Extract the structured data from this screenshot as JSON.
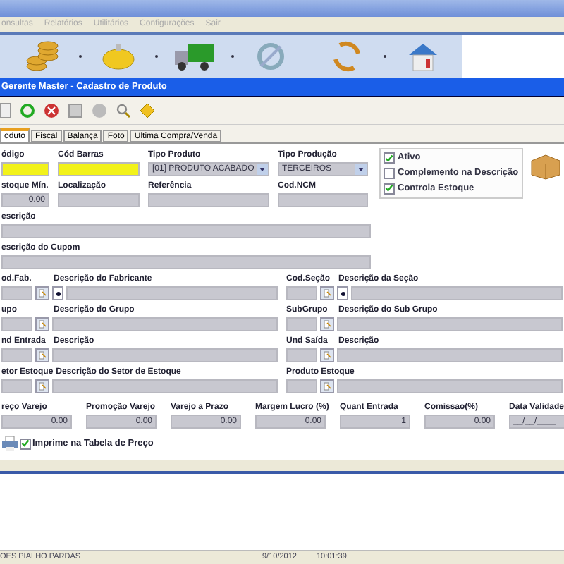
{
  "menu": [
    "onsultas",
    "Relatórios",
    "Utilitários",
    "Configurações",
    "Sair"
  ],
  "form_title": "Gerente Master - Cadastro de Produto",
  "tabs": [
    {
      "label": "oduto",
      "selected": true
    },
    {
      "label": "Fiscal",
      "selected": false
    },
    {
      "label": "Balança",
      "selected": false
    },
    {
      "label": "Foto",
      "selected": false
    },
    {
      "label": "Ultima Compra/Venda",
      "selected": false
    }
  ],
  "row_1": [
    {
      "label": "ódigo",
      "kind": "text",
      "required": true
    },
    {
      "label": "Cód Barras",
      "kind": "text",
      "required": true
    },
    {
      "label": "Tipo Produto",
      "kind": "select",
      "value": "[01] PRODUTO ACABADO"
    },
    {
      "label": "Tipo Produção",
      "kind": "select",
      "value": "TERCEIROS"
    }
  ],
  "row_2": [
    {
      "label": "stoque Mín.",
      "kind": "text",
      "value": "0.00",
      "required": false
    },
    {
      "label": "Localização",
      "kind": "text",
      "required": false
    },
    {
      "label": "Referência",
      "kind": "text",
      "required": false
    },
    {
      "label": "Cod.NCM",
      "kind": "text",
      "required": false
    }
  ],
  "options": [
    {
      "label": "Ativo",
      "checked": true
    },
    {
      "label": "Complemento na Descrição",
      "checked": false
    },
    {
      "label": "Controla Estoque",
      "checked": true
    }
  ],
  "description": {
    "label": "escrição"
  },
  "coupon_description": {
    "label": "escrição do Cupom"
  },
  "lookups": [
    {
      "code_label": "od.Fab.",
      "desc_label": "Descrição do Fabricante",
      "dot": true
    },
    {
      "code_label": "Cod.Seção",
      "desc_label": "Descrição da Seção",
      "dot": true
    },
    {
      "code_label": "upo",
      "desc_label": "Descrição do Grupo",
      "dot": false
    },
    {
      "code_label": "SubGrupo",
      "desc_label": "Descrição do Sub Grupo",
      "dot": false
    },
    {
      "code_label": "nd Entrada",
      "desc_label": "Descrição",
      "dot": false
    },
    {
      "code_label": "Und Saída",
      "desc_label": "Descrição",
      "dot": false
    },
    {
      "code_label": "etor Estoque",
      "desc_label": "Descrição do Setor de Estoque",
      "dot": false
    },
    {
      "code_label": "Produto Estoque",
      "dot": false
    }
  ],
  "prices": [
    {
      "label": "reço Varejo",
      "value": "0.00"
    },
    {
      "label": "Promoção Varejo",
      "value": "0.00"
    },
    {
      "label": "Varejo a Prazo",
      "value": "0.00"
    },
    {
      "label": "Margem Lucro (%)",
      "value": "0.00"
    },
    {
      "label": "Quant Entrada",
      "value": "1"
    },
    {
      "label": "Comissao(%)",
      "value": "0.00"
    },
    {
      "label": "Data Validade",
      "value": "__/__/____"
    }
  ],
  "print_option": {
    "label": "Imprime na Tabela de Preço",
    "checked": true
  },
  "status_bar": {
    "user": "OES PIALHO PARDAS",
    "date": "9/10/2012",
    "time": "10:01:39"
  }
}
